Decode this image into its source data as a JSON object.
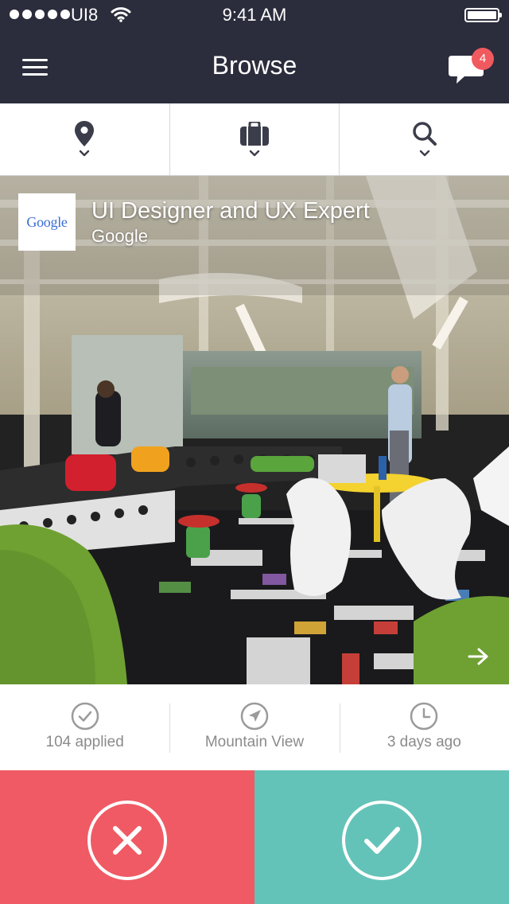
{
  "status_bar": {
    "carrier": "UI8",
    "time": "9:41 AM"
  },
  "nav": {
    "title": "Browse",
    "notification_count": "4"
  },
  "filters": [
    {
      "icon": "location-pin-icon"
    },
    {
      "icon": "briefcase-icon"
    },
    {
      "icon": "search-icon"
    }
  ],
  "job": {
    "title": "UI Designer and UX Expert",
    "company": "Google",
    "logo_text": "Google"
  },
  "stats": [
    {
      "icon": "check-circle-icon",
      "label": "104 applied"
    },
    {
      "icon": "location-arrow-icon",
      "label": "Mountain View"
    },
    {
      "icon": "clock-icon",
      "label": "3 days ago"
    }
  ],
  "actions": {
    "reject_color": "#f05a64",
    "accept_color": "#64c3b8"
  },
  "colors": {
    "header_bg": "#2b2d3c",
    "badge": "#f05a5f"
  }
}
